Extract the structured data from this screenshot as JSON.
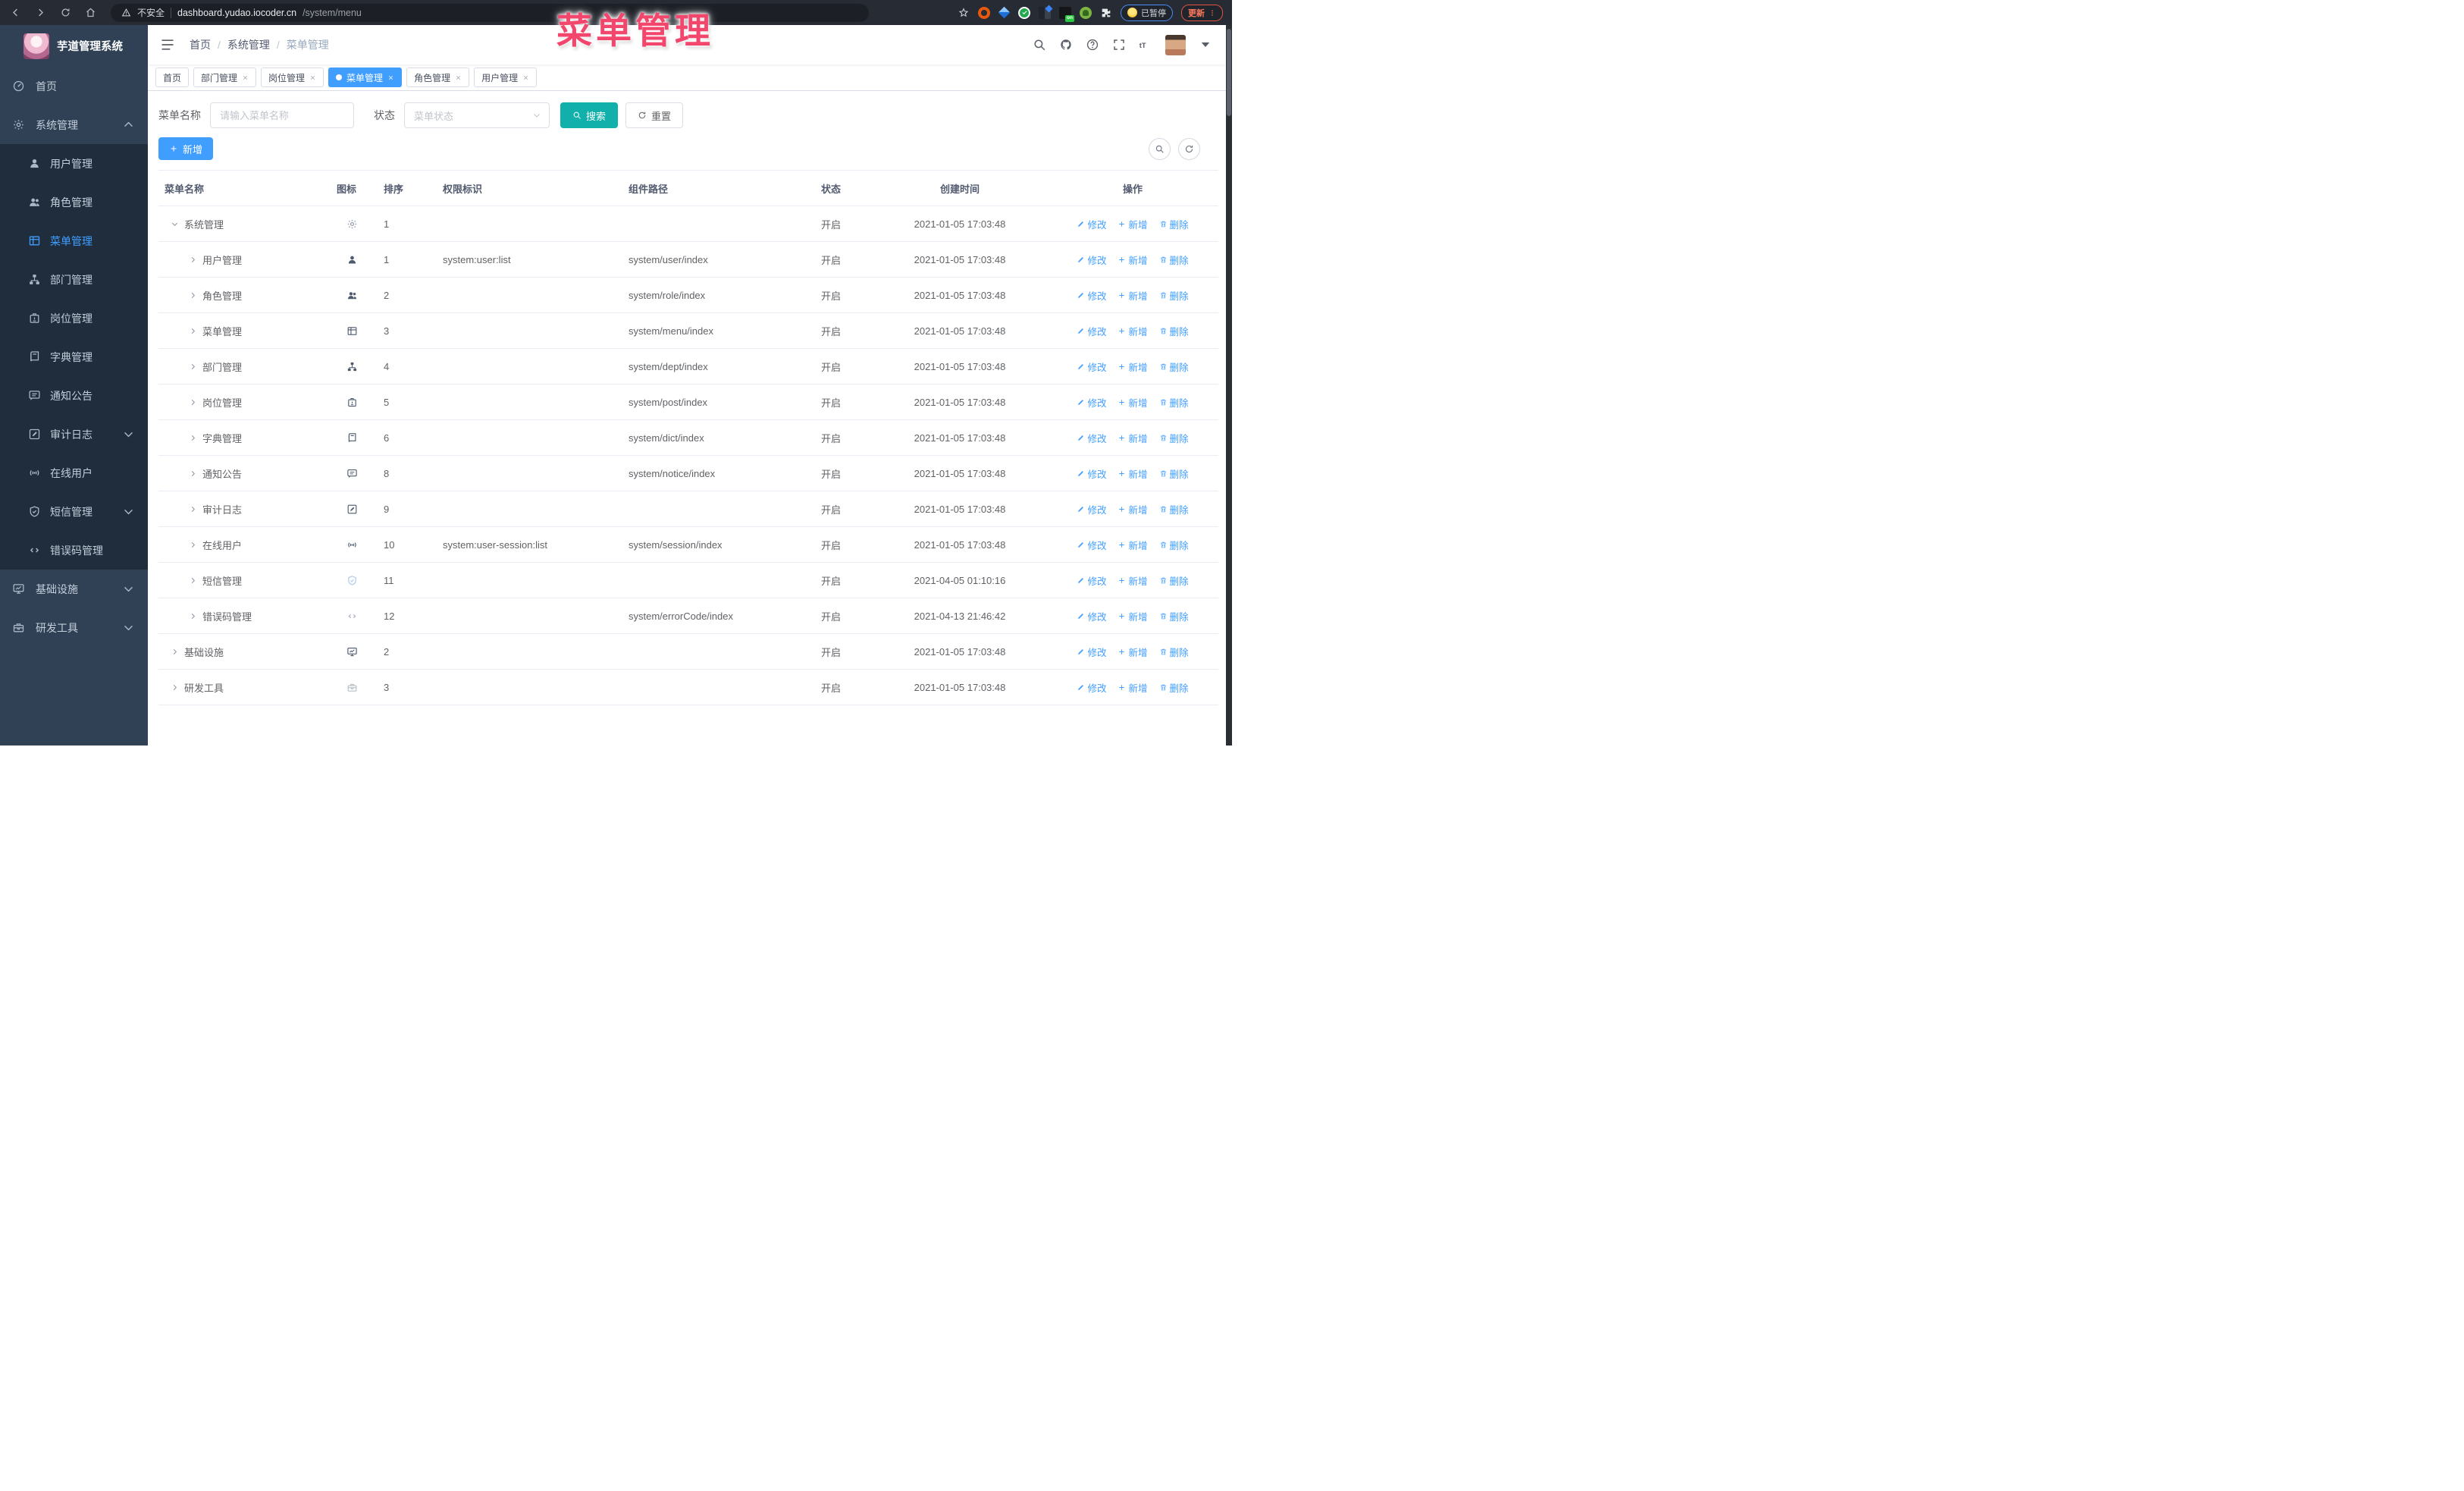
{
  "theme": {
    "accent": "#409eff",
    "teal": "#12b0ab",
    "pink": "#f3466d",
    "sidebar": "#304156",
    "submenu": "#1f2d3d"
  },
  "browser": {
    "security_label": "不安全",
    "url_host": "dashboard.yudao.iocoder.cn",
    "url_path": "/system/menu",
    "on_badge_label": "on",
    "paused_label": "已暂停",
    "update_label": "更新"
  },
  "annotation": {
    "text": "菜单管理"
  },
  "sidebar": {
    "logo_title": "芋道管理系统",
    "items": [
      {
        "label": "首页",
        "icon": "dashboard",
        "type": "top"
      },
      {
        "label": "系统管理",
        "icon": "gear",
        "type": "top",
        "chevron": "up"
      },
      {
        "label": "用户管理",
        "icon": "user",
        "type": "sub"
      },
      {
        "label": "角色管理",
        "icon": "users",
        "type": "sub"
      },
      {
        "label": "菜单管理",
        "icon": "table",
        "type": "sub",
        "active": true
      },
      {
        "label": "部门管理",
        "icon": "tree",
        "type": "sub"
      },
      {
        "label": "岗位管理",
        "icon": "badge",
        "type": "sub"
      },
      {
        "label": "字典管理",
        "icon": "book",
        "type": "sub"
      },
      {
        "label": "通知公告",
        "icon": "message",
        "type": "sub"
      },
      {
        "label": "审计日志",
        "icon": "pen",
        "type": "sub",
        "chevron": "down"
      },
      {
        "label": "在线用户",
        "icon": "online",
        "type": "sub"
      },
      {
        "label": "短信管理",
        "icon": "shield",
        "type": "sub",
        "chevron": "down"
      },
      {
        "label": "错误码管理",
        "icon": "code",
        "type": "sub"
      },
      {
        "label": "基础设施",
        "icon": "monitor",
        "type": "top",
        "chevron": "down"
      },
      {
        "label": "研发工具",
        "icon": "toolbox",
        "type": "top",
        "chevron": "down"
      }
    ]
  },
  "topbar": {
    "breadcrumb": [
      "首页",
      "系统管理",
      "菜单管理"
    ],
    "breadcrumb_separator": "/"
  },
  "tabs": [
    {
      "label": "首页",
      "closable": false,
      "active": false
    },
    {
      "label": "部门管理",
      "closable": true,
      "active": false
    },
    {
      "label": "岗位管理",
      "closable": true,
      "active": false
    },
    {
      "label": "菜单管理",
      "closable": true,
      "active": true
    },
    {
      "label": "角色管理",
      "closable": true,
      "active": false
    },
    {
      "label": "用户管理",
      "closable": true,
      "active": false
    }
  ],
  "filters": {
    "name_label": "菜单名称",
    "name_placeholder": "请输入菜单名称",
    "status_label": "状态",
    "status_placeholder": "菜单状态",
    "search_label": "搜索",
    "reset_label": "重置"
  },
  "toolbar": {
    "add_label": "新增"
  },
  "table": {
    "columns": [
      "菜单名称",
      "图标",
      "排序",
      "权限标识",
      "组件路径",
      "状态",
      "创建时间",
      "操作"
    ],
    "actions": {
      "edit": "修改",
      "add": "新增",
      "del": "删除"
    },
    "rows": [
      {
        "name": "系统管理",
        "icon": "gear",
        "icon_color": "#8a96a8",
        "indent": 0,
        "expanded": true,
        "sort": "1",
        "perm": "",
        "path": "",
        "status": "开启",
        "created": "2021-01-05 17:03:48"
      },
      {
        "name": "用户管理",
        "icon": "user",
        "indent": 1,
        "expanded": false,
        "sort": "1",
        "perm": "system:user:list",
        "path": "system/user/index",
        "status": "开启",
        "created": "2021-01-05 17:03:48"
      },
      {
        "name": "角色管理",
        "icon": "users",
        "indent": 1,
        "expanded": false,
        "sort": "2",
        "perm": "",
        "path": "system/role/index",
        "status": "开启",
        "created": "2021-01-05 17:03:48"
      },
      {
        "name": "菜单管理",
        "icon": "table",
        "indent": 1,
        "expanded": false,
        "sort": "3",
        "perm": "",
        "path": "system/menu/index",
        "status": "开启",
        "created": "2021-01-05 17:03:48"
      },
      {
        "name": "部门管理",
        "icon": "tree",
        "indent": 1,
        "expanded": false,
        "sort": "4",
        "perm": "",
        "path": "system/dept/index",
        "status": "开启",
        "created": "2021-01-05 17:03:48"
      },
      {
        "name": "岗位管理",
        "icon": "badge",
        "indent": 1,
        "expanded": false,
        "sort": "5",
        "perm": "",
        "path": "system/post/index",
        "status": "开启",
        "created": "2021-01-05 17:03:48"
      },
      {
        "name": "字典管理",
        "icon": "book",
        "indent": 1,
        "expanded": false,
        "sort": "6",
        "perm": "",
        "path": "system/dict/index",
        "status": "开启",
        "created": "2021-01-05 17:03:48"
      },
      {
        "name": "通知公告",
        "icon": "message",
        "indent": 1,
        "expanded": false,
        "sort": "8",
        "perm": "",
        "path": "system/notice/index",
        "status": "开启",
        "created": "2021-01-05 17:03:48"
      },
      {
        "name": "审计日志",
        "icon": "pen",
        "indent": 1,
        "expanded": false,
        "sort": "9",
        "perm": "",
        "path": "",
        "status": "开启",
        "created": "2021-01-05 17:03:48"
      },
      {
        "name": "在线用户",
        "icon": "online",
        "indent": 1,
        "expanded": false,
        "sort": "10",
        "perm": "system:user-session:list",
        "path": "system/session/index",
        "status": "开启",
        "created": "2021-01-05 17:03:48"
      },
      {
        "name": "短信管理",
        "icon": "shield",
        "icon_color": "#a9c7e8",
        "indent": 1,
        "expanded": false,
        "sort": "11",
        "perm": "",
        "path": "",
        "status": "开启",
        "created": "2021-04-05 01:10:16"
      },
      {
        "name": "错误码管理",
        "icon": "code",
        "icon_color": "#aab3c0",
        "indent": 1,
        "expanded": false,
        "sort": "12",
        "perm": "",
        "path": "system/errorCode/index",
        "status": "开启",
        "created": "2021-04-13 21:46:42"
      },
      {
        "name": "基础设施",
        "icon": "monitor",
        "indent": 0,
        "expanded": false,
        "sort": "2",
        "perm": "",
        "path": "",
        "status": "开启",
        "created": "2021-01-05 17:03:48"
      },
      {
        "name": "研发工具",
        "icon": "toolbox",
        "icon_color": "#b7bdc6",
        "indent": 0,
        "expanded": false,
        "sort": "3",
        "perm": "",
        "path": "",
        "status": "开启",
        "created": "2021-01-05 17:03:48"
      }
    ]
  }
}
